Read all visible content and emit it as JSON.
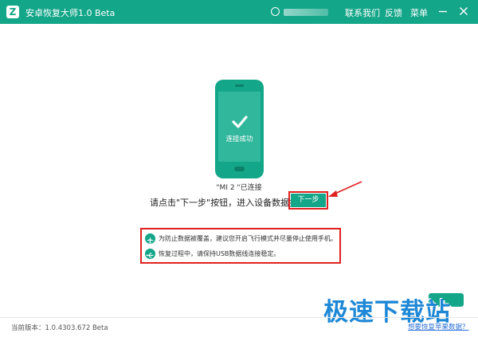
{
  "titlebar": {
    "logo_letter": "Z",
    "title": "安卓恢复大师1.0 Beta",
    "menu": {
      "contact": "联系我们",
      "feedback": "反馈",
      "menu": "菜单"
    }
  },
  "device": {
    "screen_text": "连接成功",
    "status": "\"MI 2 \"已连接"
  },
  "instruction": {
    "text": "请点击\"下一步\"按钮，进入设备数据扫描",
    "next_button": "下一步"
  },
  "tips": [
    {
      "icon": "airplane-icon",
      "text": "为防止数据被覆盖，建议您开启飞行模式并尽量停止使用手机。"
    },
    {
      "icon": "usb-icon",
      "text": "恢复过程中，请保持USB数据线连接稳定。"
    }
  ],
  "footer": {
    "version": "当前版本：1.0.4303.672 Beta",
    "ios_link": "想要恢复苹果数据？"
  },
  "watermark": {
    "text": "极速下载站"
  },
  "colors": {
    "brand": "#14a689",
    "highlight": "#e02020",
    "link": "#2a6fd6"
  }
}
